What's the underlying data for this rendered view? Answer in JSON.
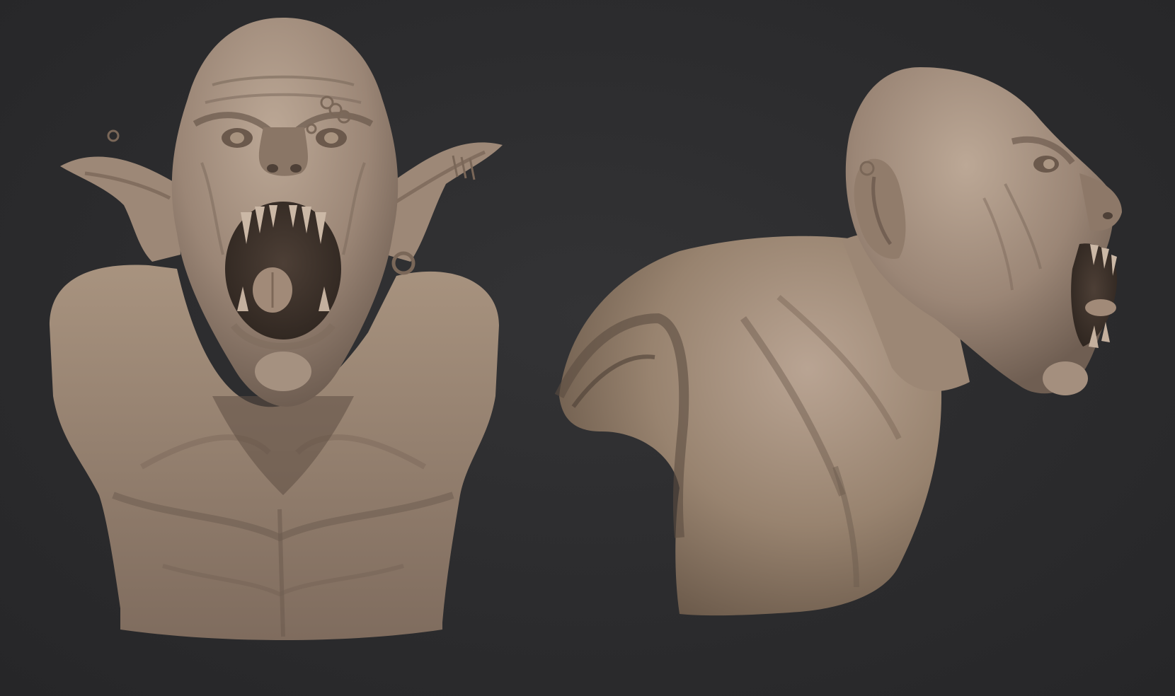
{
  "scene": {
    "background_color": "#2c2c2e",
    "material_color": "#9a8575",
    "views": [
      {
        "name": "front-view"
      },
      {
        "name": "side-view"
      }
    ]
  }
}
